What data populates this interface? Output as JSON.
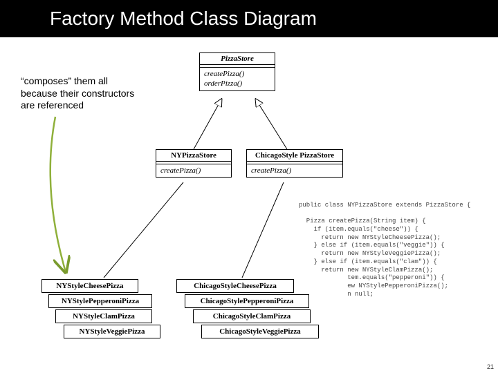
{
  "title": "Factory Method Class Diagram",
  "annotation": "“composes” them all\nbecause their constructors\nare referenced",
  "pizzaStore": {
    "name": "PizzaStore",
    "m1": "createPizza()",
    "m2": "orderPizza()"
  },
  "nyStore": {
    "name": "NYPizzaStore",
    "m1": "createPizza()"
  },
  "chicagoStore": {
    "name": "ChicagoStyle PizzaStore",
    "m1": "createPizza()"
  },
  "nyPizzas": {
    "cheese": "NYStyleCheesePizza",
    "pepperoni": "NYStylePepperoniPizza",
    "clam": "NYStyleClamPizza",
    "veggie": "NYStyleVeggiePizza"
  },
  "chicagoPizzas": {
    "cheese": "ChicagoStyleCheesePizza",
    "pepperoni": "ChicagoStylePepperoniPizza",
    "clam": "ChicagoStyleClamPizza",
    "veggie": "ChicagoStyleVeggiePizza"
  },
  "code": "public class NYPizzaStore extends PizzaStore {\n\n  Pizza createPizza(String item) {\n    if (item.equals(\"cheese\")) {\n      return new NYStyleCheesePizza();\n    } else if (item.equals(\"veggie\")) {\n      return new NYStyleVeggiePizza();\n    } else if (item.equals(\"clam\")) {\n      return new NYStyleClamPizza();\n             tem.equals(\"pepperoni\")) {\n             ew NYStylePepperoniPizza();\n             n null;\n",
  "pageNumber": "21"
}
